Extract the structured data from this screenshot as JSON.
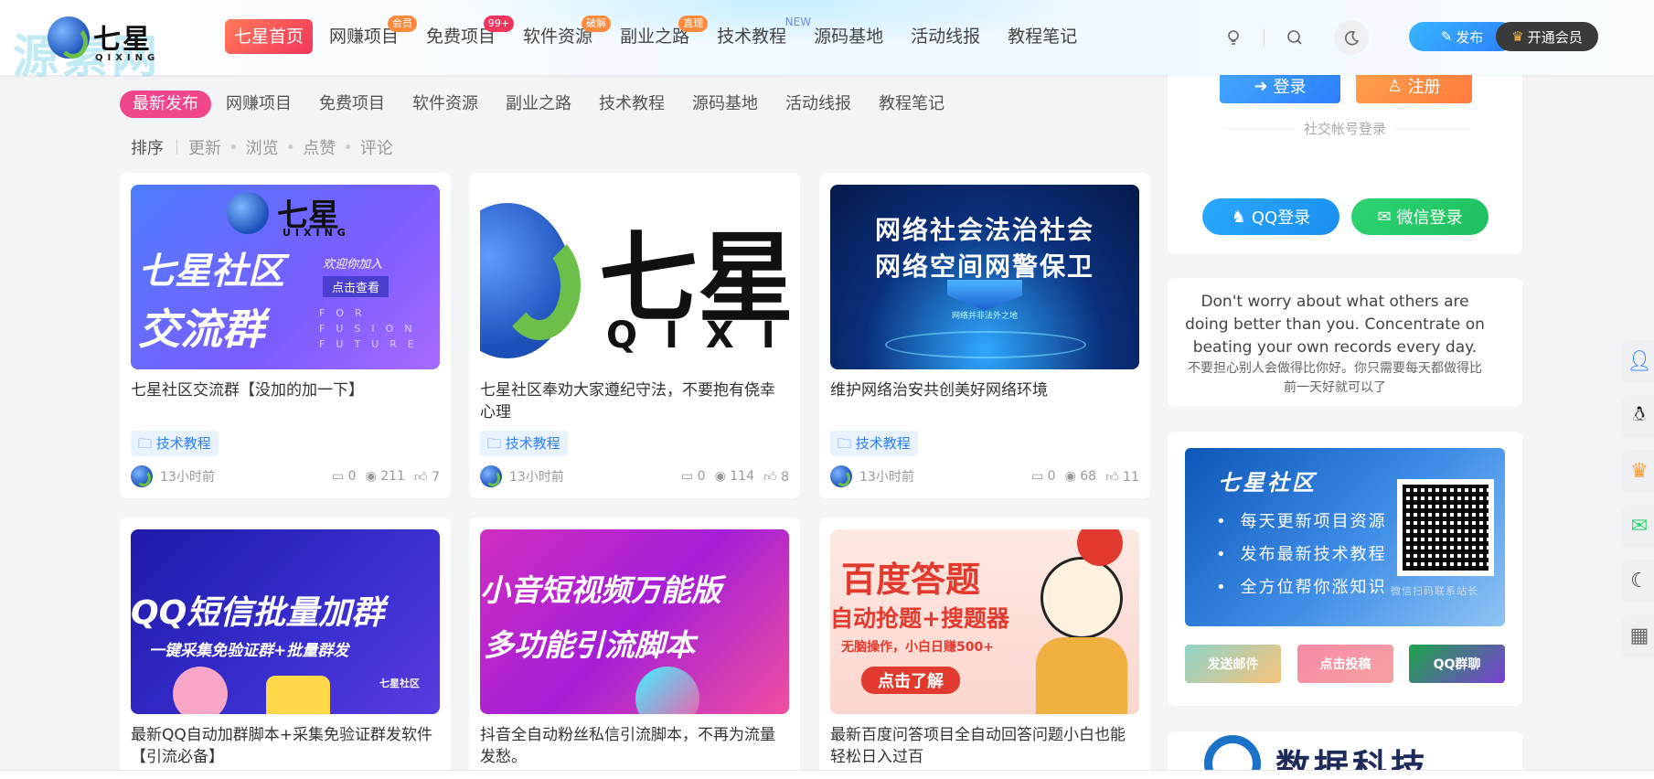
{
  "header": {
    "brand": "七星",
    "brand_en": "QIXING",
    "watermark": "源素网",
    "nav": [
      {
        "label": "七星首页",
        "badge": "",
        "active": true
      },
      {
        "label": "网赚项目",
        "badge": "会员"
      },
      {
        "label": "免费项目",
        "badge": "99+"
      },
      {
        "label": "软件资源",
        "badge": "破解"
      },
      {
        "label": "副业之路",
        "badge": "直理"
      },
      {
        "label": "技术教程",
        "badge": "NEW"
      },
      {
        "label": "源码基地",
        "badge": ""
      },
      {
        "label": "活动线报",
        "badge": ""
      },
      {
        "label": "教程笔记",
        "badge": ""
      }
    ],
    "publish_label": "发布",
    "vip_label": "开通会员"
  },
  "categories": [
    "最新发布",
    "网赚项目",
    "免费项目",
    "软件资源",
    "副业之路",
    "技术教程",
    "源码基地",
    "活动线报",
    "教程笔记"
  ],
  "sort": {
    "label": "排序",
    "options": [
      "更新",
      "浏览",
      "点赞",
      "评论"
    ]
  },
  "posts": [
    {
      "title": "七星社区交流群【没加的加一下】",
      "tag": "技术教程",
      "time": "13小时前",
      "comments": "0",
      "views": "211",
      "likes": "7",
      "thumb": {
        "line1": "七星社区",
        "line2": "交流群",
        "sub": "欢迎你加入",
        "btn": "点击查看",
        "brand": "七星",
        "brand_en": "UIXING",
        "en": "FOR FUSION FUTURE"
      }
    },
    {
      "title": "七星社区奉劝大家遵纪守法，不要抱有侥幸心理",
      "tag": "技术教程",
      "time": "13小时前",
      "comments": "0",
      "views": "114",
      "likes": "8",
      "thumb": {
        "big": "七星",
        "big_en": "QIXI"
      }
    },
    {
      "title": "维护网络治安共创美好网络环境",
      "tag": "技术教程",
      "time": "13小时前",
      "comments": "0",
      "views": "68",
      "likes": "11",
      "thumb": {
        "line1": "网络社会法治社会",
        "line2": "网络空间网警保卫",
        "sub": "网络并非法外之地"
      }
    },
    {
      "title": "最新QQ自动加群脚本+采集免验证群发软件【引流必备】",
      "tag": "",
      "time": "",
      "comments": "",
      "views": "",
      "likes": "",
      "thumb": {
        "line1": "QQ短信批量加群",
        "line2": "一键采集免验证群+批量群发",
        "brand": "七星社区"
      }
    },
    {
      "title": "抖音全自动粉丝私信引流脚本，不再为流量发愁。",
      "tag": "",
      "time": "",
      "comments": "",
      "views": "",
      "likes": "",
      "thumb": {
        "line1": "小音短视频万能版",
        "line2": "多功能引流脚本"
      }
    },
    {
      "title": "最新百度问答项目全自动回答问题小白也能轻松日入过百",
      "tag": "",
      "time": "",
      "comments": "",
      "views": "",
      "likes": "",
      "thumb": {
        "line1": "百度答题",
        "line2": "自动抢题+搜题器",
        "sub": "无脑操作，小白日赚500+",
        "btn": "点击了解"
      }
    }
  ],
  "sidebar": {
    "login_label": "登录",
    "register_label": "注册",
    "social_label": "社交帐号登录",
    "qq_label": "QQ登录",
    "wechat_label": "微信登录",
    "quote_en": "Don't worry about what others are doing better than you. Concentrate on beating your own records every day.",
    "quote_cn": "不要担心别人会做得比你好。你只需要每天都做得比前一天好就可以了",
    "banner": {
      "title": "七星社区",
      "items": [
        "每天更新项目资源",
        "发布最新技术教程",
        "全方位帮你涨知识"
      ],
      "qr_caption": "微信扫码联系站长"
    },
    "buttons": [
      "发送邮件",
      "点击投稿",
      "QQ群聊"
    ],
    "brand2": "数据科技"
  },
  "colors": {
    "accent": "#f0468c",
    "primary": "#2d7ff9",
    "nav_active": "#f5365c"
  }
}
